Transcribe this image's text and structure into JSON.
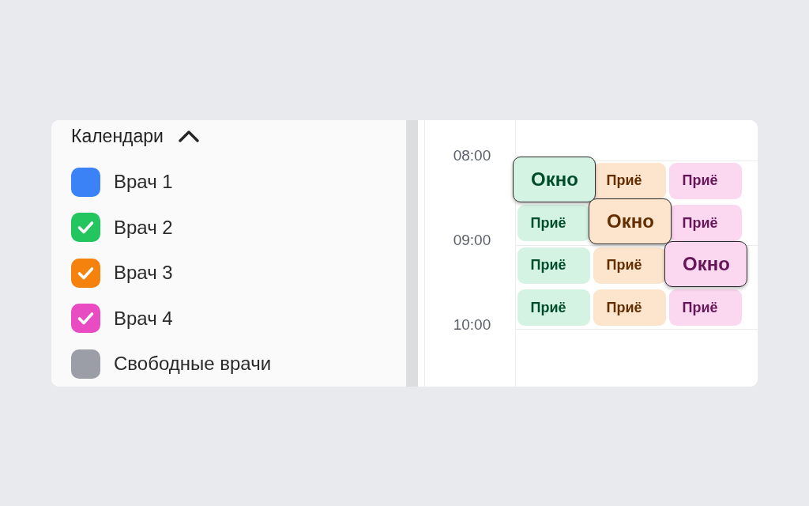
{
  "calendars": {
    "title": "Календари",
    "expanded": true,
    "items": [
      {
        "label": "Врач 1",
        "checked": false,
        "color": "#3b82f6"
      },
      {
        "label": "Врач 2",
        "checked": true,
        "color": "#22c55e"
      },
      {
        "label": "Врач 3",
        "checked": true,
        "color": "#f5820d"
      },
      {
        "label": "Врач 4",
        "checked": true,
        "color": "#e94bc3"
      },
      {
        "label": "Свободные врачи",
        "checked": false,
        "color": "#9b9ea7"
      }
    ]
  },
  "schedule": {
    "times": [
      "08:00",
      "09:00",
      "10:00"
    ],
    "columns": [
      {
        "color": "#d4f3e2",
        "events": [
          {
            "kind": "window",
            "label": "Окно"
          },
          {
            "kind": "appointment",
            "label": "Приё"
          },
          {
            "kind": "appointment",
            "label": "Приё"
          },
          {
            "kind": "appointment",
            "label": "Приё"
          }
        ]
      },
      {
        "color": "#fde4cc",
        "events": [
          {
            "kind": "appointment",
            "label": "Приё"
          },
          {
            "kind": "window",
            "label": "Окно"
          },
          {
            "kind": "appointment",
            "label": "Приё"
          },
          {
            "kind": "appointment",
            "label": "Приё"
          }
        ]
      },
      {
        "color": "#fbd7f0",
        "events": [
          {
            "kind": "appointment",
            "label": "Приё"
          },
          {
            "kind": "appointment",
            "label": "Приё"
          },
          {
            "kind": "window",
            "label": "Окно"
          },
          {
            "kind": "appointment",
            "label": "Приё"
          }
        ]
      }
    ]
  }
}
